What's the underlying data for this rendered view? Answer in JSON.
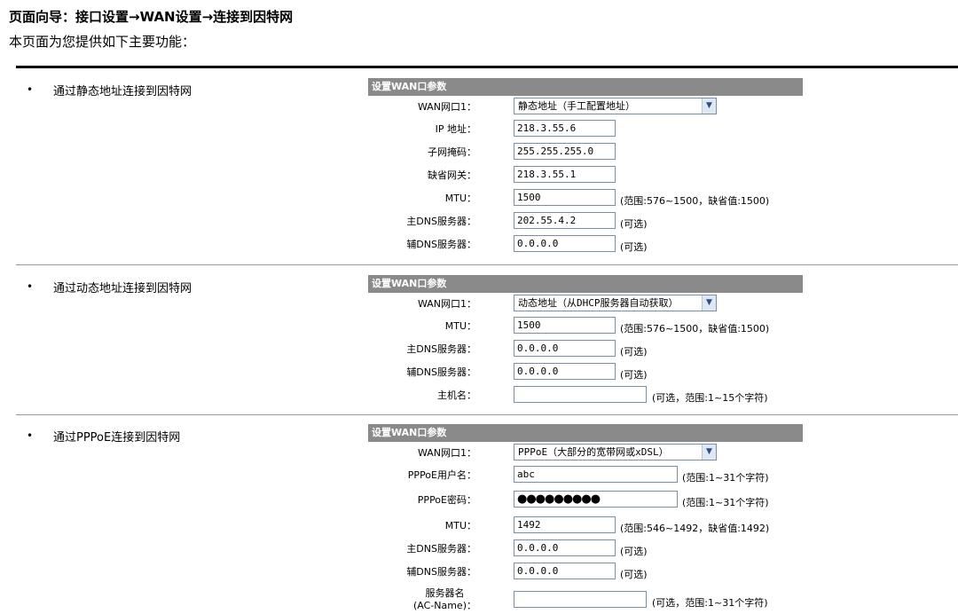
{
  "page": {
    "title": "页面向导：接口设置→WAN设置→连接到因特网",
    "intro": "本页面为您提供如下主要功能："
  },
  "bullet_glyph": "•",
  "sections": {
    "static": {
      "label": "通过静态地址连接到因特网",
      "header": "设置WAN口参数",
      "wan_label": "WAN网口1：",
      "wan_value": "静态地址（手工配置地址）",
      "ip_label": "IP 地址：",
      "ip_value": "218.3.55.6",
      "mask_label": "子网掩码：",
      "mask_value": "255.255.255.0",
      "gw_label": "缺省网关：",
      "gw_value": "218.3.55.1",
      "mtu_label": "MTU：",
      "mtu_value": "1500",
      "mtu_hint": "(范围:576~1500，缺省值:1500)",
      "dns1_label": "主DNS服务器：",
      "dns1_value": "202.55.4.2",
      "dns1_hint": "(可选)",
      "dns2_label": "辅DNS服务器：",
      "dns2_value": "0.0.0.0",
      "dns2_hint": "(可选)"
    },
    "dhcp": {
      "label": "通过动态地址连接到因特网",
      "header": "设置WAN口参数",
      "wan_label": "WAN网口1：",
      "wan_value": "动态地址（从DHCP服务器自动获取）",
      "mtu_label": "MTU：",
      "mtu_value": "1500",
      "mtu_hint": "(范围:576~1500，缺省值:1500)",
      "dns1_label": "主DNS服务器：",
      "dns1_value": "0.0.0.0",
      "dns1_hint": "(可选)",
      "dns2_label": "辅DNS服务器：",
      "dns2_value": "0.0.0.0",
      "dns2_hint": "(可选)",
      "host_label": "主机名：",
      "host_value": "",
      "host_hint": "(可选，范围:1~15个字符)"
    },
    "pppoe": {
      "label": "通过PPPoE连接到因特网",
      "header": "设置WAN口参数",
      "wan_label": "WAN网口1：",
      "wan_value": "PPPoE（大部分的宽带网或xDSL）",
      "user_label": "PPPoE用户名：",
      "user_value": "abc",
      "user_hint": "(范围:1~31个字符)",
      "pwd_label": "PPPoE密码：",
      "pwd_value": "●●●●●●●●●",
      "pwd_hint": "(范围:1~31个字符)",
      "mtu_label": "MTU：",
      "mtu_value": "1492",
      "mtu_hint": "(范围:546~1492，缺省值:1492)",
      "dns1_label": "主DNS服务器：",
      "dns1_value": "0.0.0.0",
      "dns1_hint": "(可选)",
      "dns2_label": "辅DNS服务器：",
      "dns2_value": "0.0.0.0",
      "dns2_hint": "(可选)",
      "ac_label_1": "服务器名",
      "ac_label_2": "(AC-Name)：",
      "ac_value": "",
      "ac_hint": "(可选，范围:1~31个字符)"
    }
  }
}
